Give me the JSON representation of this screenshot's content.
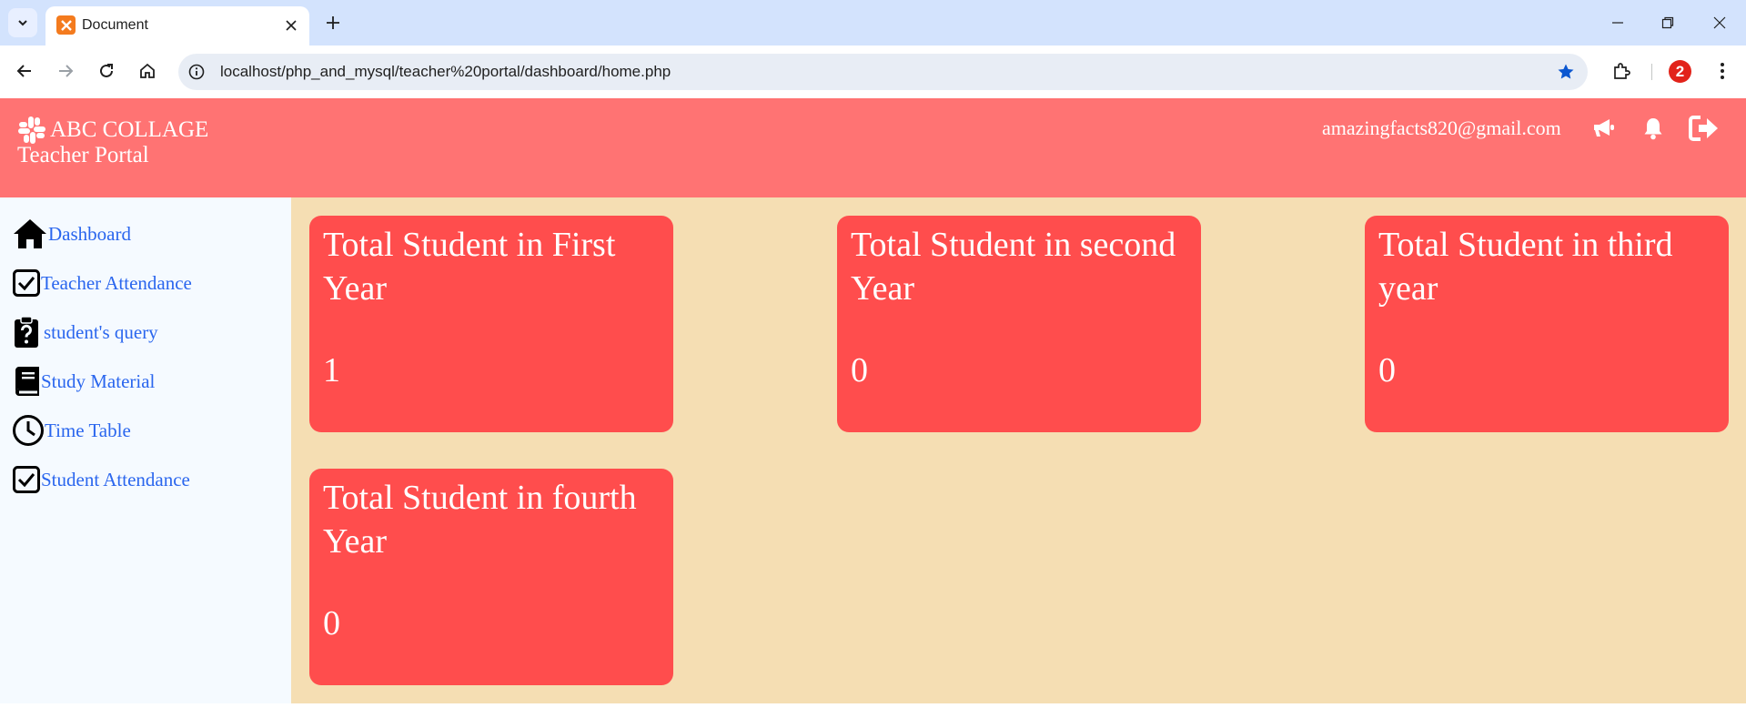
{
  "browser": {
    "tab_title": "Document",
    "url": "localhost/php_and_mysql/teacher%20portal/dashboard/home.php",
    "profile_badge": "2"
  },
  "header": {
    "brand": "ABC COLLAGE",
    "subtitle": "Teacher Portal",
    "email": "amazingfacts820@gmail.com"
  },
  "sidebar": {
    "items": [
      {
        "label": "Dashboard",
        "icon": "home-icon"
      },
      {
        "label": "Teacher Attendance",
        "icon": "checkbox-icon"
      },
      {
        "label": "student's query",
        "icon": "clipboard-question-icon"
      },
      {
        "label": "Study Material",
        "icon": "book-icon"
      },
      {
        "label": "Time Table",
        "icon": "clock-icon"
      },
      {
        "label": "Student Attendance",
        "icon": "checkbox-icon"
      }
    ]
  },
  "cards": [
    {
      "title": "Total Student in First Year",
      "value": "1"
    },
    {
      "title": "Total Student in second Year",
      "value": "0"
    },
    {
      "title": "Total Student in third year",
      "value": "0"
    },
    {
      "title": "Total Student in fourth Year",
      "value": "0"
    }
  ],
  "colors": {
    "header_bg": "#ff7373",
    "card_bg": "#ff4d4d",
    "main_bg": "#f5deb3",
    "sidebar_bg": "#f5faff",
    "link": "#2a66ee"
  }
}
